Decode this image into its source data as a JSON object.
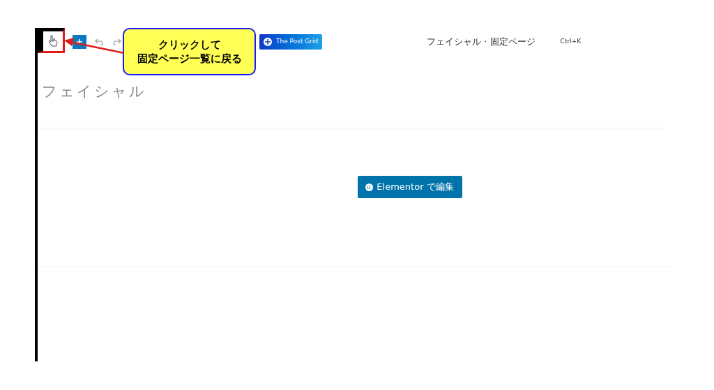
{
  "toolbar": {
    "post_grid_button": "The Post Grid",
    "document_title": "フェイシャル · 固定ページ",
    "shortcut": "Ctrl+K"
  },
  "callout": {
    "lines": [
      "クリックして",
      "固定ページ一覧に戻る"
    ]
  },
  "page": {
    "title": "フェイシャル",
    "edit_button": "Elementor で編集"
  }
}
